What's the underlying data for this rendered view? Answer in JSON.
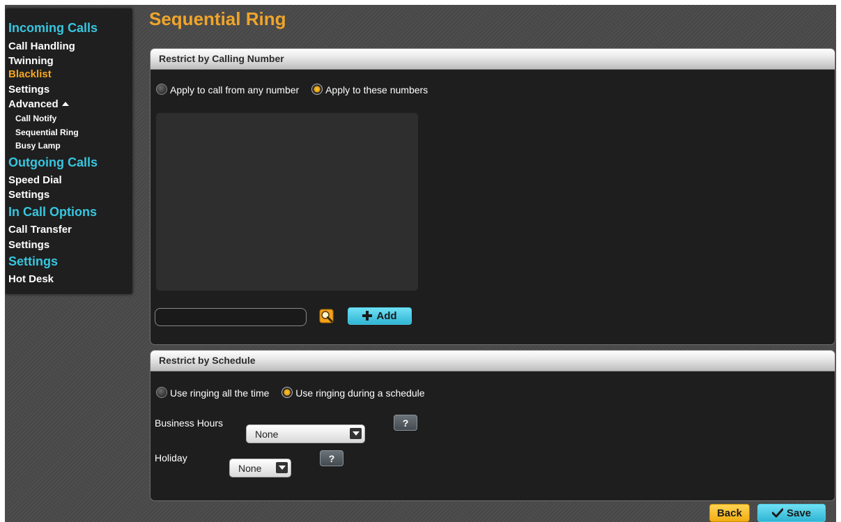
{
  "title": "Sequential Ring",
  "sidebar": {
    "incoming_header": "Incoming Calls",
    "incoming_items": [
      "Call Handling",
      "Twinning",
      "Blacklist",
      "Settings"
    ],
    "advanced_label": "Advanced",
    "advanced_subitems": [
      "Call Notify",
      "Sequential Ring",
      "Busy Lamp"
    ],
    "outgoing_header": "Outgoing Calls",
    "outgoing_items": [
      "Speed Dial",
      "Settings"
    ],
    "in_call_header": "In Call Options",
    "in_call_items": [
      "Call Transfer",
      "Settings"
    ],
    "settings_header": "Settings",
    "settings_items": [
      "Hot Desk"
    ]
  },
  "calling_number": {
    "header": "Restrict by Calling Number",
    "option_any": "Apply to call from any number",
    "option_these": "Apply to these numbers",
    "selected": "option_these",
    "number_input_value": "",
    "add_label": "Add"
  },
  "schedule": {
    "header": "Restrict by Schedule",
    "option_all": "Use ringing all the time",
    "option_schedule": "Use ringing during a schedule",
    "selected": "option_schedule",
    "business_hours_label": "Business Hours",
    "business_hours_value": "None",
    "holiday_label": "Holiday",
    "holiday_value": "None",
    "help_label": "?"
  },
  "footer": {
    "back_label": "Back",
    "save_label": "Save"
  },
  "colors": {
    "accent_orange": "#f0a52a",
    "accent_cyan": "#37c6e0",
    "panel_bg": "#1e1e1e"
  }
}
